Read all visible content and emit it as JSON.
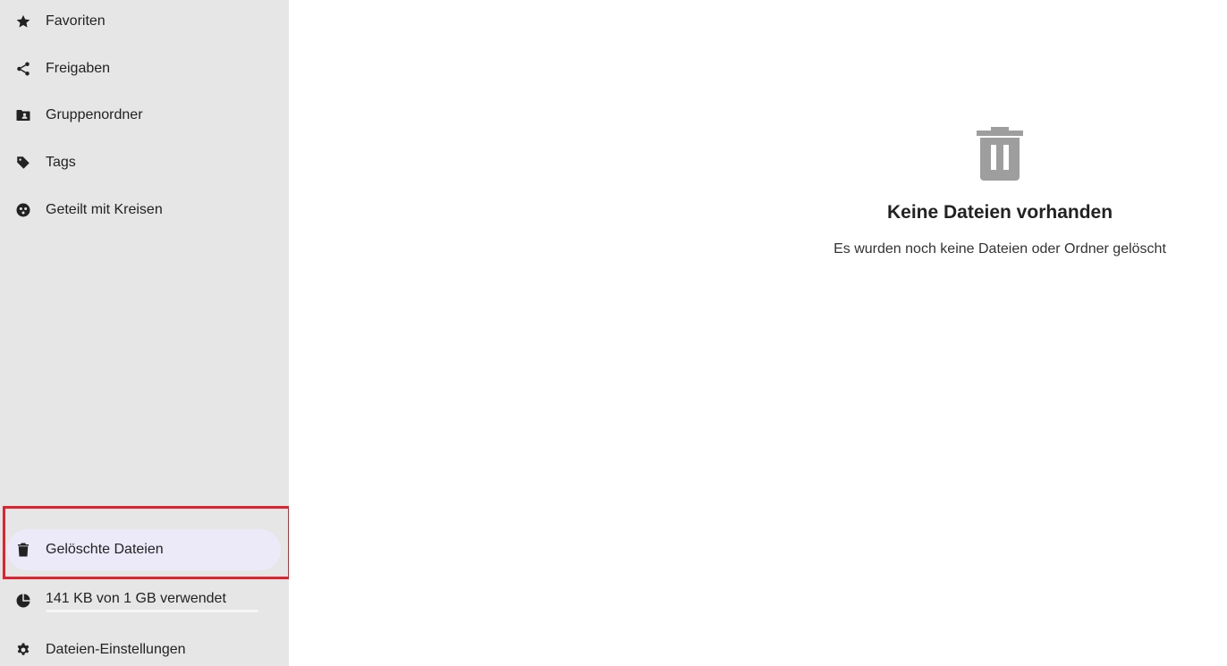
{
  "sidebar": {
    "items": [
      {
        "label": "Favoriten",
        "icon": "star-icon"
      },
      {
        "label": "Freigaben",
        "icon": "share-icon"
      },
      {
        "label": "Gruppenordner",
        "icon": "group-folder-icon"
      },
      {
        "label": "Tags",
        "icon": "tag-icon"
      },
      {
        "label": "Geteilt mit Kreisen",
        "icon": "circles-icon"
      }
    ],
    "trash": {
      "label": "Gelöschte Dateien",
      "icon": "trash-icon",
      "active": true
    },
    "quota": {
      "label": "141 KB von 1 GB verwendet",
      "icon": "pie-chart-icon",
      "used_fraction": 0.0001
    },
    "settings": {
      "label": "Dateien-Einstellungen",
      "icon": "gear-icon"
    }
  },
  "main": {
    "empty_state": {
      "icon": "trash-icon",
      "title": "Keine Dateien vorhanden",
      "description": "Es wurden noch keine Dateien oder Ordner gelöscht"
    }
  },
  "colors": {
    "sidebar_bg": "#e6e6e6",
    "active_item_bg": "#ece9f8",
    "highlight_border": "#e0232e",
    "empty_icon": "#9e9e9e"
  }
}
